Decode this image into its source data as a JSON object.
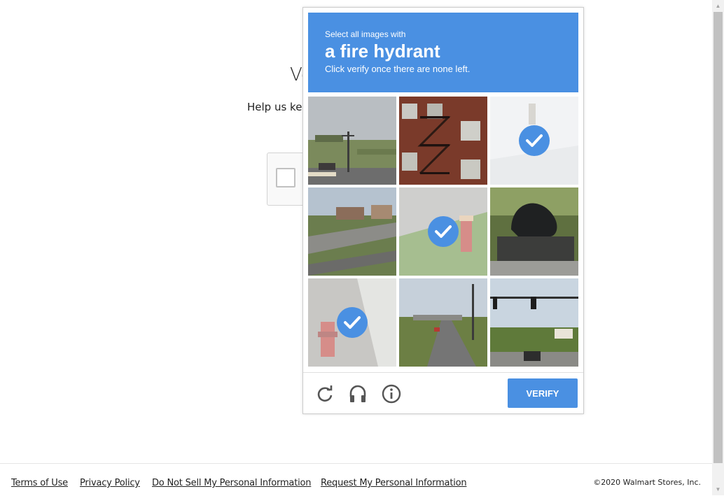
{
  "page": {
    "title": "Ve",
    "subtitle": "Help us kee"
  },
  "captcha": {
    "instruction_line1": "Select all images with",
    "target": "a fire hydrant",
    "instruction_line3": "Click verify once there are none left.",
    "verify_label": "VERIFY",
    "tiles": [
      {
        "scene": "street with utility pole and car",
        "selected": false
      },
      {
        "scene": "brick building with fire escape",
        "selected": false
      },
      {
        "scene": "faded snow scene",
        "selected": true
      },
      {
        "scene": "road intersection with houses",
        "selected": false
      },
      {
        "scene": "red fire hydrant on grass",
        "selected": true
      },
      {
        "scene": "dark statue",
        "selected": false
      },
      {
        "scene": "red fire hydrant near curb",
        "selected": true
      },
      {
        "scene": "street with overpass and power poles",
        "selected": false
      },
      {
        "scene": "traffic lights over road",
        "selected": false
      }
    ],
    "icons": {
      "reload": "reload-icon",
      "audio": "headphones-icon",
      "info": "info-icon",
      "check": "check-icon"
    },
    "accent": "#4a90e2"
  },
  "footer": {
    "links": [
      "Terms of Use",
      "Privacy Policy",
      "Do Not Sell My Personal Information",
      "Request My Personal Information"
    ],
    "copyright": "©2020 Walmart Stores, Inc."
  }
}
